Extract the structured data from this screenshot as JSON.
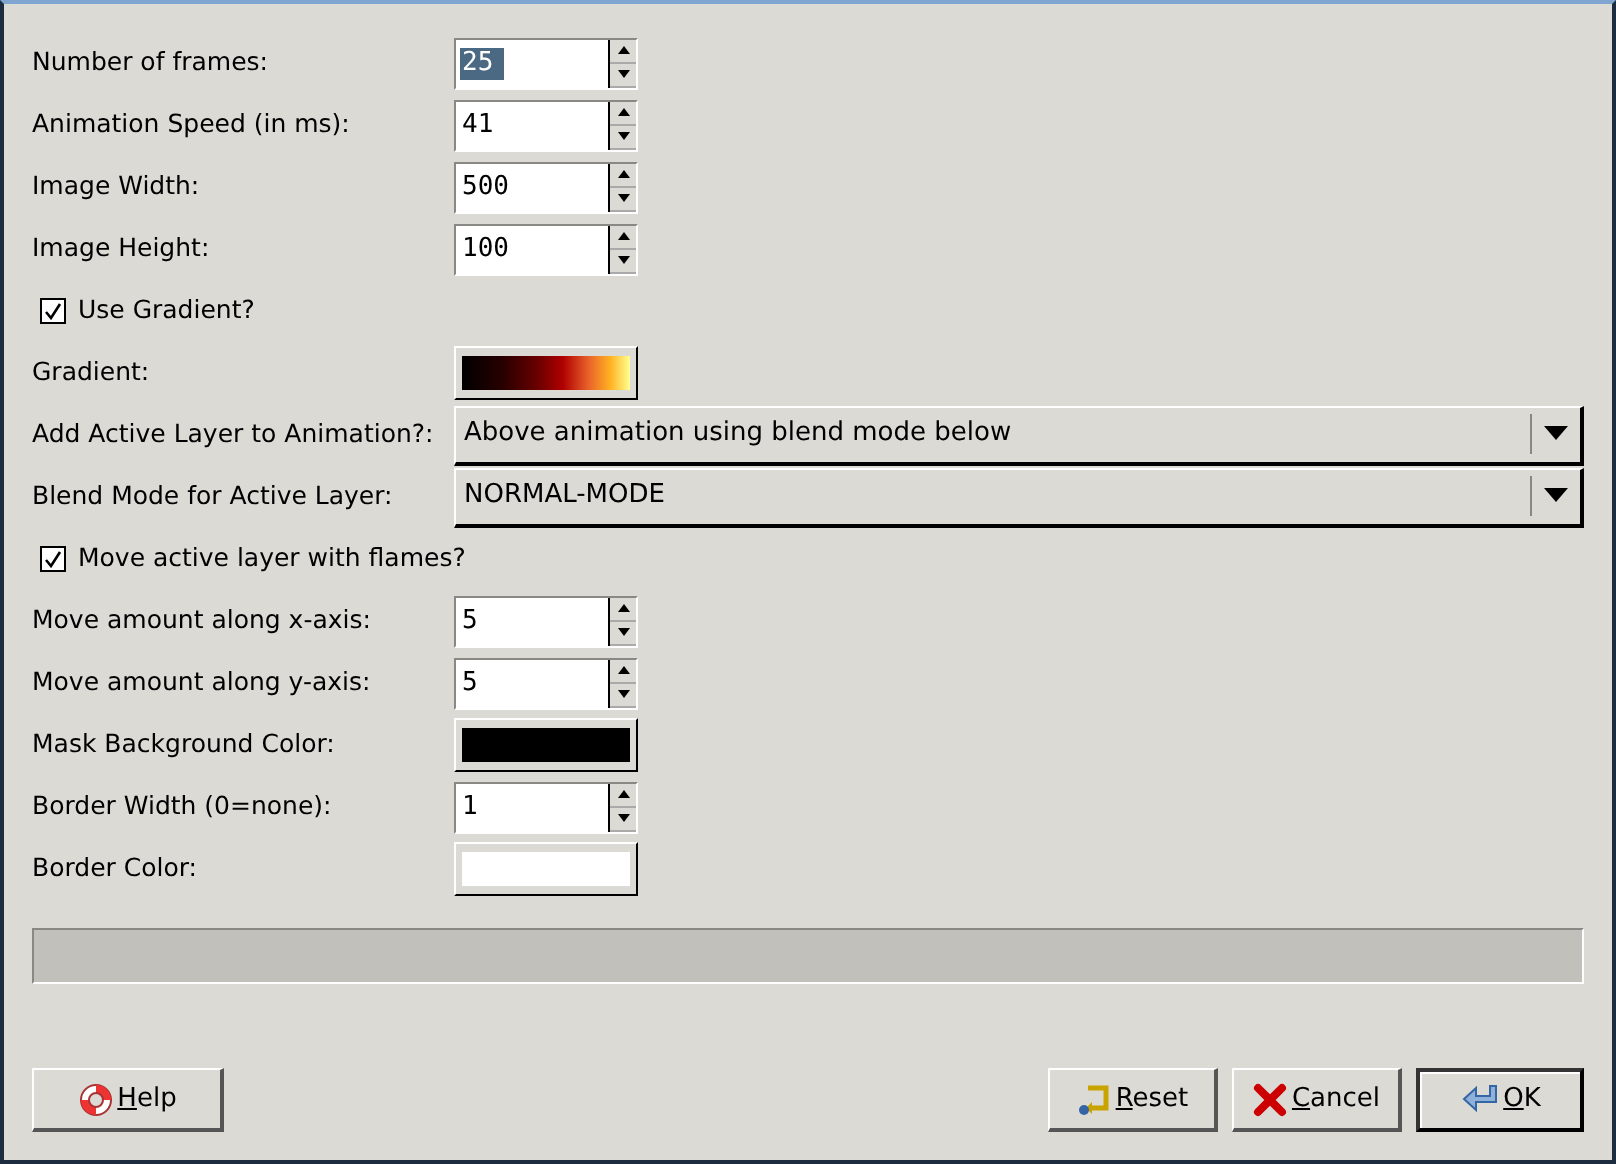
{
  "fields": [
    {
      "kind": "spin",
      "label": "Number of frames:",
      "value": "25",
      "text_selected": true
    },
    {
      "kind": "spin",
      "label": "Animation Speed (in ms):",
      "value": "41",
      "text_selected": false
    },
    {
      "kind": "spin",
      "label": "Image Width:",
      "value": "500",
      "text_selected": false
    },
    {
      "kind": "spin",
      "label": "Image Height:",
      "value": "100",
      "text_selected": false
    },
    {
      "kind": "checkbox",
      "label": "Use Gradient?",
      "checked": true
    },
    {
      "kind": "gradient",
      "label": "Gradient:"
    },
    {
      "kind": "combo",
      "label": "Add Active Layer to Animation?:",
      "value": "Above animation using blend mode below"
    },
    {
      "kind": "combo",
      "label": "Blend Mode for Active Layer:",
      "value": "NORMAL-MODE"
    },
    {
      "kind": "checkbox",
      "label": "Move active layer with flames?",
      "checked": true
    },
    {
      "kind": "spin",
      "label": "Move amount along x-axis:",
      "value": "5",
      "text_selected": false
    },
    {
      "kind": "spin",
      "label": "Move amount along y-axis:",
      "value": "5",
      "text_selected": false
    },
    {
      "kind": "color",
      "label": "Mask Background Color:",
      "color": "#000000"
    },
    {
      "kind": "spin",
      "label": "Border Width (0=none):",
      "value": "1",
      "text_selected": false
    },
    {
      "kind": "color",
      "label": "Border Color:",
      "color": "#ffffff"
    }
  ],
  "progress": {
    "level": 0
  },
  "buttons": [
    {
      "kind": "help",
      "label": "Help",
      "mnemonic": true,
      "default": false
    },
    {
      "kind": "reset",
      "label": "Reset",
      "mnemonic": true,
      "default": false
    },
    {
      "kind": "cancel",
      "label": "Cancel",
      "mnemonic": true,
      "default": false
    },
    {
      "kind": "ok",
      "label": "OK",
      "mnemonic": true,
      "default": true
    }
  ]
}
